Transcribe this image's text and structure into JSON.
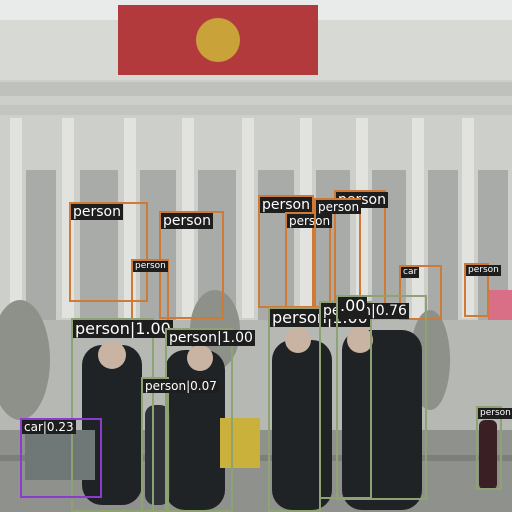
{
  "image": {
    "description_colors": {
      "sky": "#e9ebea",
      "building": "#c9cbc6",
      "banner": "#b8343a",
      "ground": "#9a9a96"
    },
    "box_colors": {
      "orange": "#cf7a37",
      "green": "#8fa274",
      "purple": "#8a3ccf"
    }
  },
  "detections": [
    {
      "label": "person",
      "color": "orange",
      "label_size": "large"
    },
    {
      "label": "person",
      "color": "orange",
      "label_size": "large"
    },
    {
      "label": "person",
      "color": "orange",
      "label_size": "large"
    },
    {
      "label": "person",
      "color": "orange",
      "label_size": "medium"
    },
    {
      "label": "person",
      "color": "orange",
      "label_size": "large"
    },
    {
      "label": "person",
      "color": "orange",
      "label_size": "medium"
    },
    {
      "label": "person",
      "color": "orange",
      "label_size": "small"
    },
    {
      "label": "car",
      "color": "orange",
      "label_size": "small"
    },
    {
      "label": "person",
      "color": "orange",
      "label_size": "small"
    },
    {
      "label": "person|1.00",
      "color": "green",
      "label_size": "xlarge"
    },
    {
      "label": "person|1.00",
      "color": "green",
      "label_size": "large"
    },
    {
      "label": "person|1.00",
      "color": "green",
      "label_size": "xlarge"
    },
    {
      "label": "person|0.76",
      "color": "green",
      "label_size": "large"
    },
    {
      "label": "person|0.07",
      "color": "green",
      "label_size": "medium"
    },
    {
      "label": ".00",
      "color": "green",
      "label_size": "xlarge"
    },
    {
      "label": "person",
      "color": "green",
      "label_size": "small"
    },
    {
      "label": "car|0.23",
      "color": "purple",
      "label_size": "medium"
    }
  ]
}
